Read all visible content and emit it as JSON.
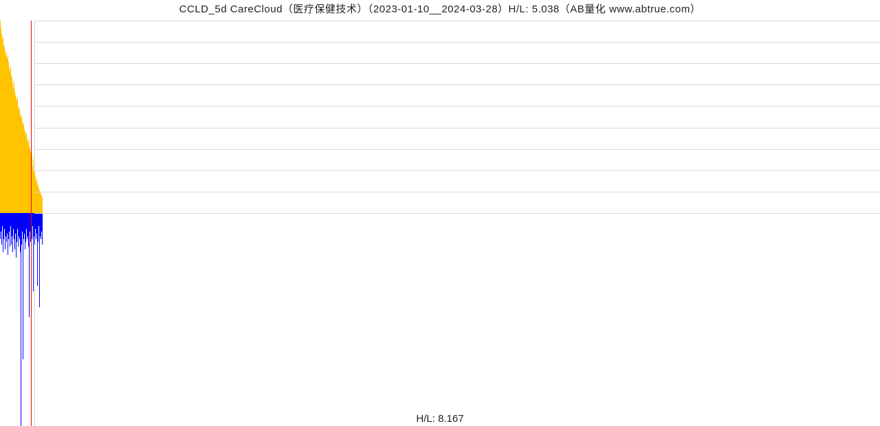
{
  "title_full": "CCLD_5d CareCloud（医疗保健技术）（2023-01-10__2024-03-28）H/L: 5.038（AB量化  www.abtrue.com）",
  "footer_text": "H/L: 8.167",
  "colors": {
    "bar_up": "#ffc300",
    "bar_down": "#0000ff",
    "vline": "#ff0000",
    "grid": "#d9d9d9"
  },
  "chart_data": {
    "type": "bar",
    "title": "CCLD_5d CareCloud（医疗保健技术）（2023-01-10__2024-03-28）H/L: 5.038（AB量化  www.abtrue.com）",
    "subtitle": "H/L: 8.167",
    "xlabel": "",
    "ylabel": "",
    "ylim_upper": [
      0,
      5.038
    ],
    "ylim_lower": [
      -8.167,
      0
    ],
    "grid_rows_upper": 9,
    "red_vline_x_index": 45,
    "categories_note": "5-day samples from 2023-01-10 to 2024-03-28, approx 62 points",
    "series": [
      {
        "name": "upper_yellow",
        "color": "#ffc300",
        "values": [
          5.03,
          4.85,
          4.7,
          4.55,
          4.6,
          4.4,
          4.35,
          4.2,
          4.25,
          4.1,
          4.05,
          4.15,
          3.95,
          3.8,
          3.7,
          3.85,
          3.6,
          3.55,
          3.4,
          3.3,
          3.45,
          3.2,
          3.1,
          3.0,
          2.95,
          3.05,
          2.8,
          2.7,
          2.75,
          2.6,
          2.5,
          2.55,
          2.4,
          2.3,
          2.35,
          2.2,
          2.15,
          2.05,
          2.1,
          1.95,
          1.85,
          1.9,
          1.75,
          1.7,
          1.6,
          0.1,
          1.55,
          1.2,
          1.4,
          1.1,
          1.05,
          0.95,
          0.85,
          0.9,
          0.75,
          0.7,
          0.65,
          0.6,
          0.55,
          0.5,
          0.45,
          0.4
        ]
      },
      {
        "name": "lower_blue",
        "color": "#0000ff",
        "values": [
          1.0,
          0.7,
          1.2,
          0.5,
          1.5,
          1.0,
          0.6,
          1.4,
          0.9,
          1.1,
          0.8,
          1.6,
          1.0,
          0.7,
          1.3,
          0.5,
          1.2,
          0.9,
          1.5,
          0.6,
          1.0,
          1.4,
          0.8,
          1.7,
          1.1,
          0.6,
          1.3,
          0.9,
          1.0,
          1.5,
          8.167,
          1.2,
          0.7,
          5.6,
          1.0,
          0.8,
          1.4,
          1.1,
          0.6,
          1.0,
          0.9,
          1.3,
          4.0,
          0.7,
          1.1,
          0.2,
          1.0,
          0.5,
          3.0,
          0.9,
          1.2,
          0.6,
          1.0,
          0.8,
          2.8,
          1.1,
          0.5,
          3.6,
          0.9,
          1.0,
          0.7,
          1.2
        ]
      }
    ]
  }
}
